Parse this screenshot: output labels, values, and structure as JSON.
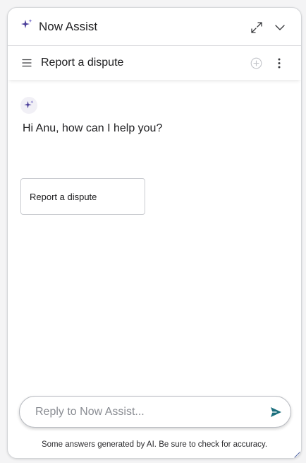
{
  "header": {
    "title": "Now Assist",
    "icons": [
      "sparkle-icon",
      "expand-icon",
      "chevron-down-icon"
    ]
  },
  "conversation_bar": {
    "title": "Report a dispute",
    "icons": [
      "menu-icon",
      "add-conversation-icon",
      "more-vertical-icon"
    ]
  },
  "chat": {
    "greeting": "Hi Anu, how can I help you?",
    "suggestions": [
      {
        "label": "Report a dispute"
      }
    ]
  },
  "composer": {
    "placeholder": "Reply to Now Assist...",
    "value": ""
  },
  "footer": {
    "disclaimer": "Some answers generated by AI. Be sure to check for accuracy."
  },
  "colors": {
    "sparkle_primary": "#4b3f9a",
    "sparkle_secondary": "#6e64c4",
    "send_icon": "#1b6f7d",
    "border": "#d3d5d8"
  }
}
